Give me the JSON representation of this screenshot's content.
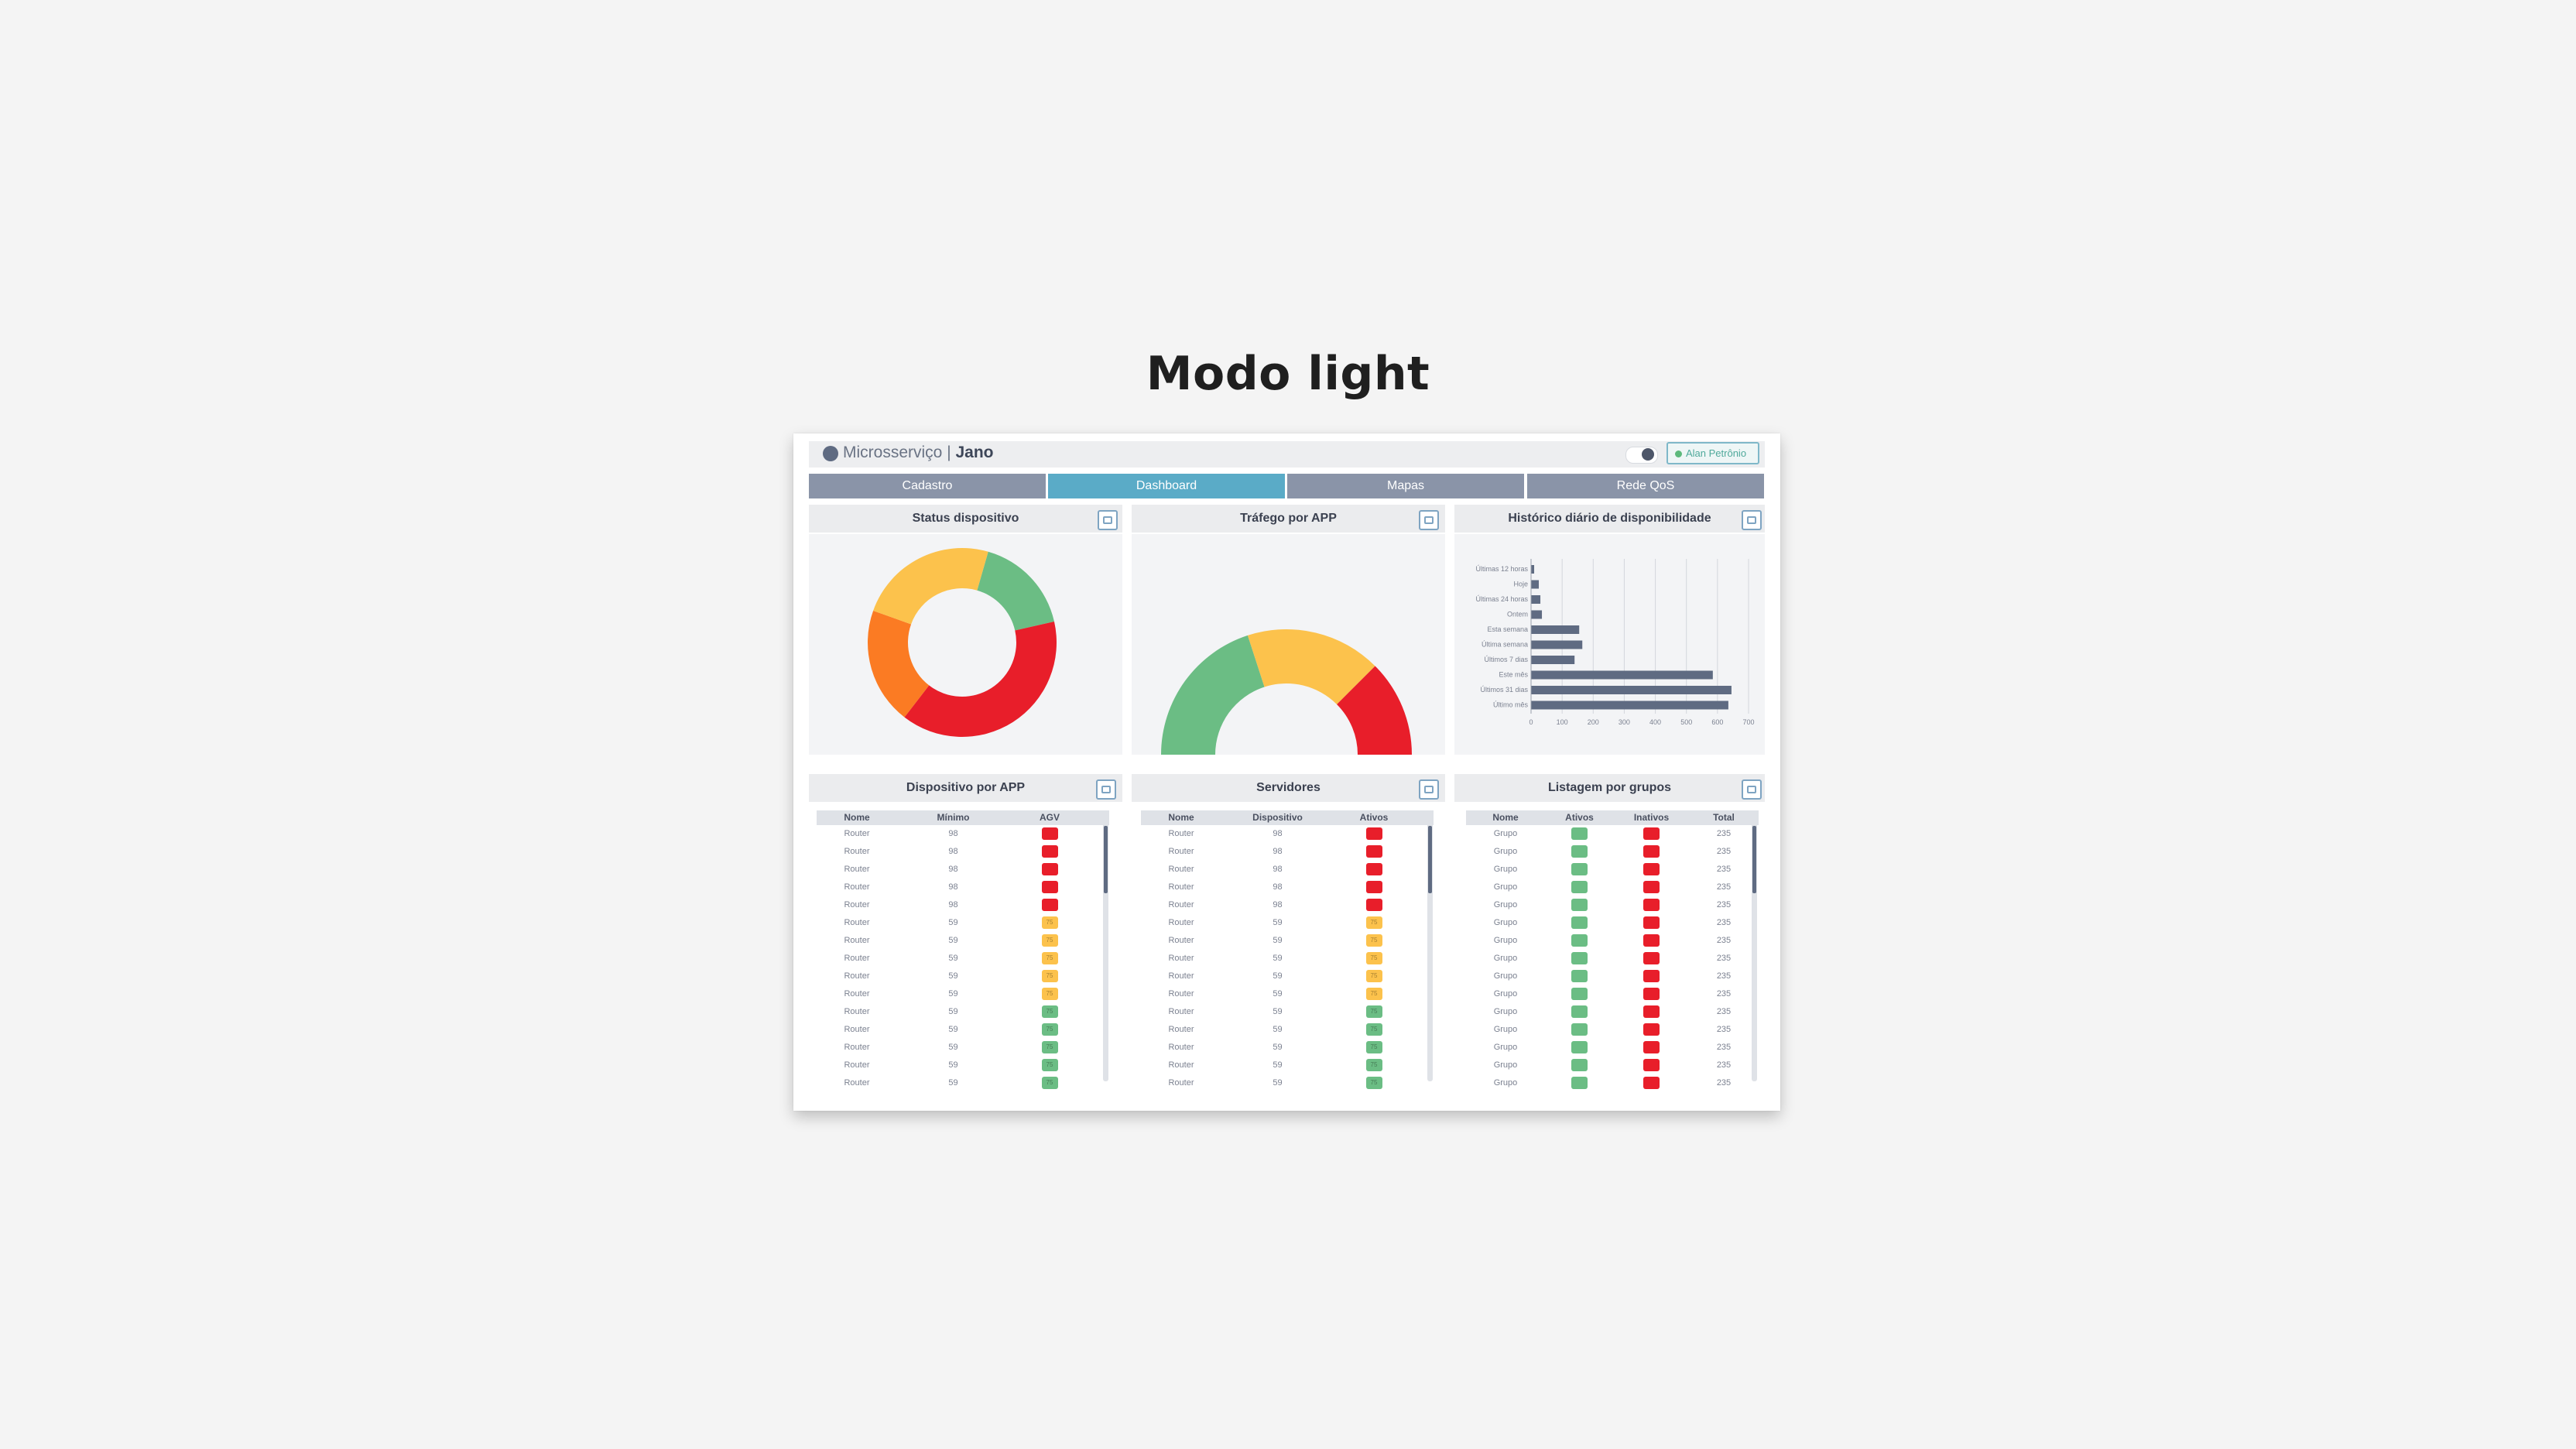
{
  "heading": "Modo light",
  "app": {
    "name": "Microsserviço",
    "separator": " | ",
    "module": "Jano",
    "user": "Alan Petrônio",
    "user_status_color": "#5cb97c"
  },
  "tabs": [
    {
      "label": "Cadastro",
      "active": false
    },
    {
      "label": "Dashboard",
      "active": true
    },
    {
      "label": "Mapas",
      "active": false
    },
    {
      "label": "Rede QoS",
      "active": false
    }
  ],
  "panels": {
    "status": {
      "title": "Status dispositivo"
    },
    "trafego": {
      "title": "Tráfego por APP"
    },
    "historico": {
      "title": "Histórico diário de disponibilidade"
    },
    "dispositivo_app": {
      "title": "Dispositivo por APP",
      "columns": [
        "Nome",
        "Mínimo",
        "AGV"
      ]
    },
    "servidores": {
      "title": "Servidores",
      "columns": [
        "Nome",
        "Dispositivo",
        "Ativos"
      ]
    },
    "grupos": {
      "title": "Listagem por grupos",
      "columns": [
        "Nome",
        "Ativos",
        "Inativos",
        "Total"
      ]
    }
  },
  "colors": {
    "red": "#e81e2a",
    "yellow": "#fcc24c",
    "green": "#6bbd84",
    "orange": "#fb7b23",
    "bar": "#5f6b82",
    "tab": "#8a94a8",
    "tab_active": "#5aabc7"
  },
  "chart_data": [
    {
      "type": "pie",
      "title": "Status dispositivo",
      "slices": [
        {
          "color": "#6bbd84",
          "value": 17
        },
        {
          "color": "#e81e2a",
          "value": 39
        },
        {
          "color": "#fb7b23",
          "value": 20
        },
        {
          "color": "#fcc24c",
          "value": 24
        }
      ]
    },
    {
      "type": "pie",
      "title": "Tráfego por APP",
      "half": true,
      "slices": [
        {
          "color": "#6bbd84",
          "value": 40
        },
        {
          "color": "#fcc24c",
          "value": 35
        },
        {
          "color": "#e81e2a",
          "value": 25
        }
      ]
    },
    {
      "type": "bar",
      "orientation": "horizontal",
      "title": "Histórico diário de disponibilidade",
      "categories": [
        "Últimas 12 horas",
        "Hoje",
        "Últimas 24 horas",
        "Ontem",
        "Esta semana",
        "Última semana",
        "Últimos 7 dias",
        "Este mês",
        "Últimos 31 dias",
        "Último mês"
      ],
      "values": [
        10,
        25,
        30,
        35,
        155,
        165,
        140,
        585,
        645,
        635
      ],
      "xlim": [
        0,
        700
      ],
      "xticks": [
        "0",
        "100",
        "200",
        "300",
        "400",
        "500",
        "600",
        "700"
      ],
      "grid": true
    }
  ],
  "tables": {
    "dispositivo_app": [
      [
        "Router",
        "98",
        "red",
        ""
      ],
      [
        "Router",
        "98",
        "red",
        ""
      ],
      [
        "Router",
        "98",
        "red",
        ""
      ],
      [
        "Router",
        "98",
        "red",
        ""
      ],
      [
        "Router",
        "98",
        "red",
        ""
      ],
      [
        "Router",
        "59",
        "yellow",
        "75"
      ],
      [
        "Router",
        "59",
        "yellow",
        "75"
      ],
      [
        "Router",
        "59",
        "yellow",
        "75"
      ],
      [
        "Router",
        "59",
        "yellow",
        "75"
      ],
      [
        "Router",
        "59",
        "yellow",
        "75"
      ],
      [
        "Router",
        "59",
        "green",
        "75"
      ],
      [
        "Router",
        "59",
        "green",
        "75"
      ],
      [
        "Router",
        "59",
        "green",
        "75"
      ],
      [
        "Router",
        "59",
        "green",
        "75"
      ],
      [
        "Router",
        "59",
        "green",
        "75"
      ]
    ],
    "servidores": [
      [
        "Router",
        "98",
        "red",
        ""
      ],
      [
        "Router",
        "98",
        "red",
        ""
      ],
      [
        "Router",
        "98",
        "red",
        ""
      ],
      [
        "Router",
        "98",
        "red",
        ""
      ],
      [
        "Router",
        "98",
        "red",
        ""
      ],
      [
        "Router",
        "59",
        "yellow",
        "75"
      ],
      [
        "Router",
        "59",
        "yellow",
        "75"
      ],
      [
        "Router",
        "59",
        "yellow",
        "75"
      ],
      [
        "Router",
        "59",
        "yellow",
        "75"
      ],
      [
        "Router",
        "59",
        "yellow",
        "75"
      ],
      [
        "Router",
        "59",
        "green",
        "75"
      ],
      [
        "Router",
        "59",
        "green",
        "75"
      ],
      [
        "Router",
        "59",
        "green",
        "75"
      ],
      [
        "Router",
        "59",
        "green",
        "75"
      ],
      [
        "Router",
        "59",
        "green",
        "75"
      ]
    ],
    "grupos": [
      [
        "Grupo",
        "235"
      ],
      [
        "Grupo",
        "235"
      ],
      [
        "Grupo",
        "235"
      ],
      [
        "Grupo",
        "235"
      ],
      [
        "Grupo",
        "235"
      ],
      [
        "Grupo",
        "235"
      ],
      [
        "Grupo",
        "235"
      ],
      [
        "Grupo",
        "235"
      ],
      [
        "Grupo",
        "235"
      ],
      [
        "Grupo",
        "235"
      ],
      [
        "Grupo",
        "235"
      ],
      [
        "Grupo",
        "235"
      ],
      [
        "Grupo",
        "235"
      ],
      [
        "Grupo",
        "235"
      ],
      [
        "Grupo",
        "235"
      ]
    ]
  }
}
